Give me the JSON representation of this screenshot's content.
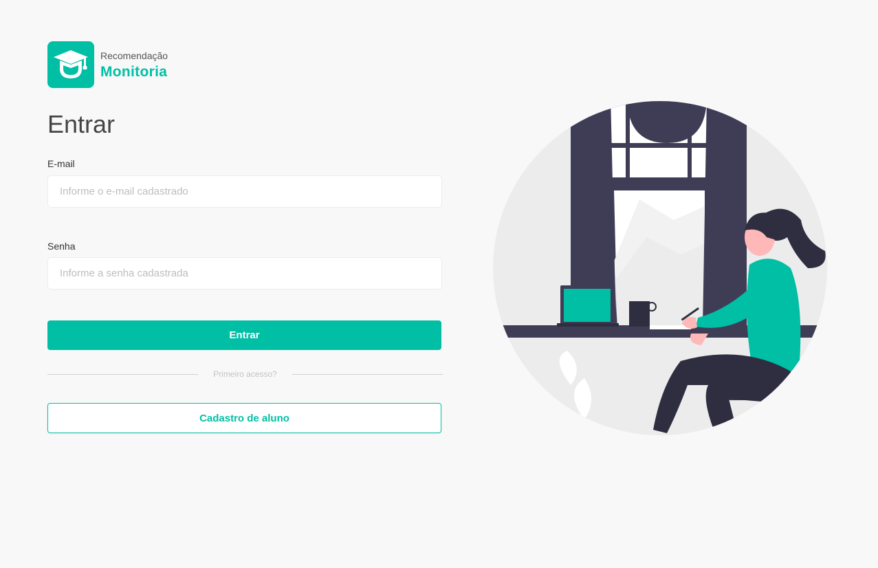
{
  "brand": {
    "subtitle": "Recomendação",
    "name": "Monitoria",
    "accent_color": "#00bfa5",
    "logo_icon": "graduation-cap-icon"
  },
  "login": {
    "title": "Entrar",
    "email": {
      "label": "E-mail",
      "value": "",
      "placeholder": "Informe o e-mail cadastrado"
    },
    "password": {
      "label": "Senha",
      "value": "",
      "placeholder": "Informe a senha cadastrada"
    },
    "submit_label": "Entrar",
    "divider_text": "Primeiro acesso?",
    "register_label": "Cadastro de aluno"
  },
  "illustration": {
    "icon": "woman-at-window-desk-illustration",
    "colors": {
      "circle": "#ececec",
      "dark": "#3f3d56",
      "accent": "#00bfa5",
      "skin": "#ffb8b8"
    }
  }
}
